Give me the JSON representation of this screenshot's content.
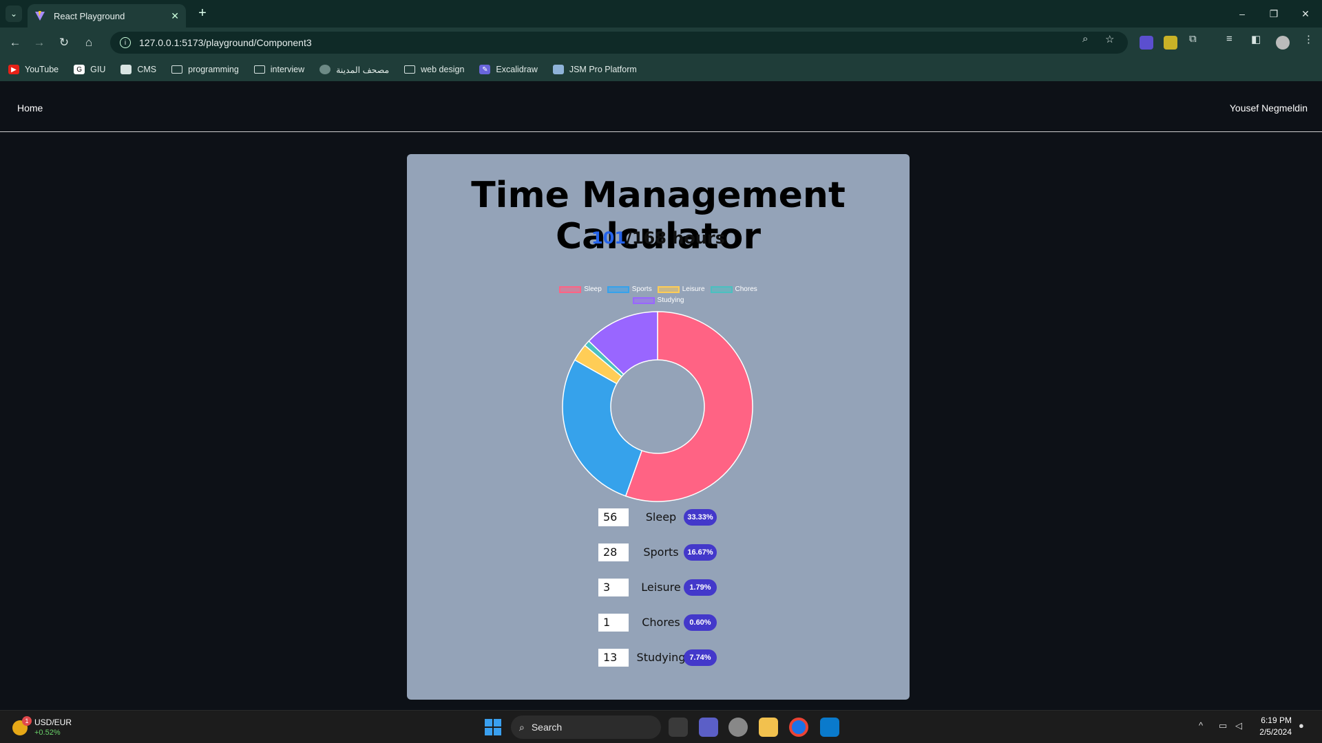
{
  "browser": {
    "tab_title": "React Playground",
    "tab_close": "✕",
    "new_tab": "+",
    "url": "127.0.0.1:5173/playground/Component3",
    "window_controls": [
      "–",
      "❐",
      "✕"
    ]
  },
  "bookmarks": [
    {
      "label": "YouTube",
      "icon": "youtube-icon"
    },
    {
      "label": "GIU",
      "icon": "g-icon"
    },
    {
      "label": "CMS",
      "icon": "page-icon"
    },
    {
      "label": "programming",
      "icon": "folder-icon"
    },
    {
      "label": "interview",
      "icon": "folder-icon"
    },
    {
      "label": "مصحف المدينة",
      "icon": "site-icon"
    },
    {
      "label": "web design",
      "icon": "folder-icon"
    },
    {
      "label": "Excalidraw",
      "icon": "excalidraw-icon"
    },
    {
      "label": "JSM Pro Platform",
      "icon": "site-icon"
    }
  ],
  "nav": {
    "home": "Home",
    "user": "Yousef Negmeldin"
  },
  "app": {
    "title": "Time Management Calculator",
    "hours_used": "101",
    "hours_total": "/168 hours"
  },
  "chart_data": {
    "type": "pie",
    "categories": [
      "Sleep",
      "Sports",
      "Leisure",
      "Chores",
      "Studying"
    ],
    "values": [
      56,
      28,
      3,
      1,
      13
    ],
    "colors": [
      "#ff6384",
      "#36a2eb",
      "#ffcd56",
      "#4bc0c0",
      "#9966ff"
    ],
    "legend_position": "top"
  },
  "activities": [
    {
      "value": "56",
      "label": "Sleep",
      "percent": "33.33%"
    },
    {
      "value": "28",
      "label": "Sports",
      "percent": "16.67%"
    },
    {
      "value": "3",
      "label": "Leisure",
      "percent": "1.79%"
    },
    {
      "value": "1",
      "label": "Chores",
      "percent": "0.60%"
    },
    {
      "value": "13",
      "label": "Studying",
      "percent": "7.74%"
    }
  ],
  "taskbar": {
    "ticker_symbol": "USD/EUR",
    "ticker_change": "+0.52%",
    "ticker_badge": "1",
    "search": "Search",
    "time": "6:19 PM",
    "date": "2/5/2024"
  }
}
